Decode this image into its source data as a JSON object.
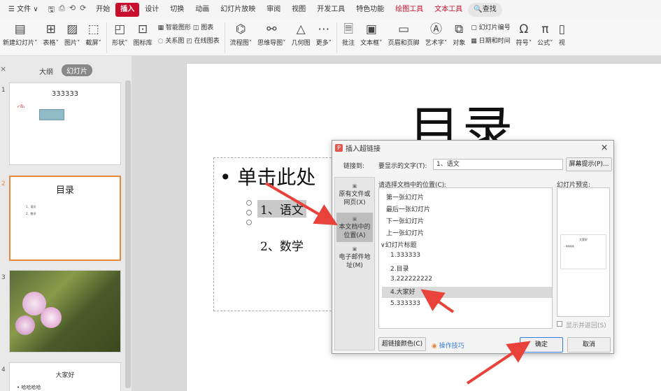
{
  "menubar": {
    "file": "☰ 文件 ∨",
    "quick_icons": [
      "🖫",
      "⎙",
      "⟲",
      "⟳"
    ],
    "tabs": [
      "开始",
      "插入",
      "设计",
      "切换",
      "动画",
      "幻灯片放映",
      "审阅",
      "视图",
      "开发工具",
      "特色功能",
      "绘图工具",
      "文本工具"
    ],
    "search": "🔍查找"
  },
  "ribbon": {
    "new_slide": "新建幻灯片˅",
    "table": "表格˅",
    "picture": "图片˅",
    "screenshot": "截屏˅",
    "shape": "形状˅",
    "icon_lib": "图标库",
    "smart_art": "智能图形",
    "chart": "图表",
    "relation": "关系图",
    "online_chart": "在线图表",
    "flowchart": "流程图˅",
    "mindmap": "思维导图˅",
    "geometry": "几何图",
    "more": "更多˅",
    "comment": "批注",
    "textbox": "文本框˅",
    "header_footer": "页眉和页脚",
    "wordart": "艺术字˅",
    "object": "对象",
    "slide_number": "幻灯片编号",
    "datetime": "日期和时间",
    "symbol": "符号˅",
    "formula": "公式˅",
    "video": "视"
  },
  "leftpanel": {
    "close": "×",
    "tab_outline": "大纲",
    "tab_slides": "幻灯片",
    "thumbs": [
      {
        "num": "1",
        "title": "333333",
        "sub": "✓B₁"
      },
      {
        "num": "2",
        "title": "目录",
        "line1": "1、语文",
        "line2": "2、数学"
      },
      {
        "num": "3"
      },
      {
        "num": "4",
        "title": "大家好",
        "sub": "• 哈哈哈哈"
      }
    ]
  },
  "slide": {
    "title": "目录",
    "bullet": "• 单击此处",
    "item1": "1、语文",
    "item2": "2、数学"
  },
  "dialog": {
    "title": "插入超链接",
    "link_to": "链接到:",
    "display_text_label": "要显示的文字(T):",
    "display_text_value": "1、语文",
    "screen_tip": "屏幕提示(P)...",
    "nav": {
      "existing_file": "原有文件或网页(X)",
      "this_doc": "本文档中的位置(A)",
      "email": "电子邮件地址(M)"
    },
    "place_label": "请选择文档中的位置(C):",
    "tree": [
      "第一张幻灯片",
      "最后一张幻灯片",
      "下一张幻灯片",
      "上一张幻灯片",
      "∨幻灯片标题",
      "1.333333",
      "2.目录",
      "3.222222222",
      "4.大家好",
      "5.333333"
    ],
    "preview_label": "幻灯片预览:",
    "preview_title": "大家好",
    "preview_line": "• 哈哈哈哈",
    "show_return": "显示并返回(S)",
    "link_color": "超链接颜色(C)",
    "tips": "操作技巧",
    "ok": "确定",
    "cancel": "取消"
  },
  "colors": {
    "accent": "#c8102e",
    "arrow": "#e8423a",
    "selection": "#e6893a"
  }
}
